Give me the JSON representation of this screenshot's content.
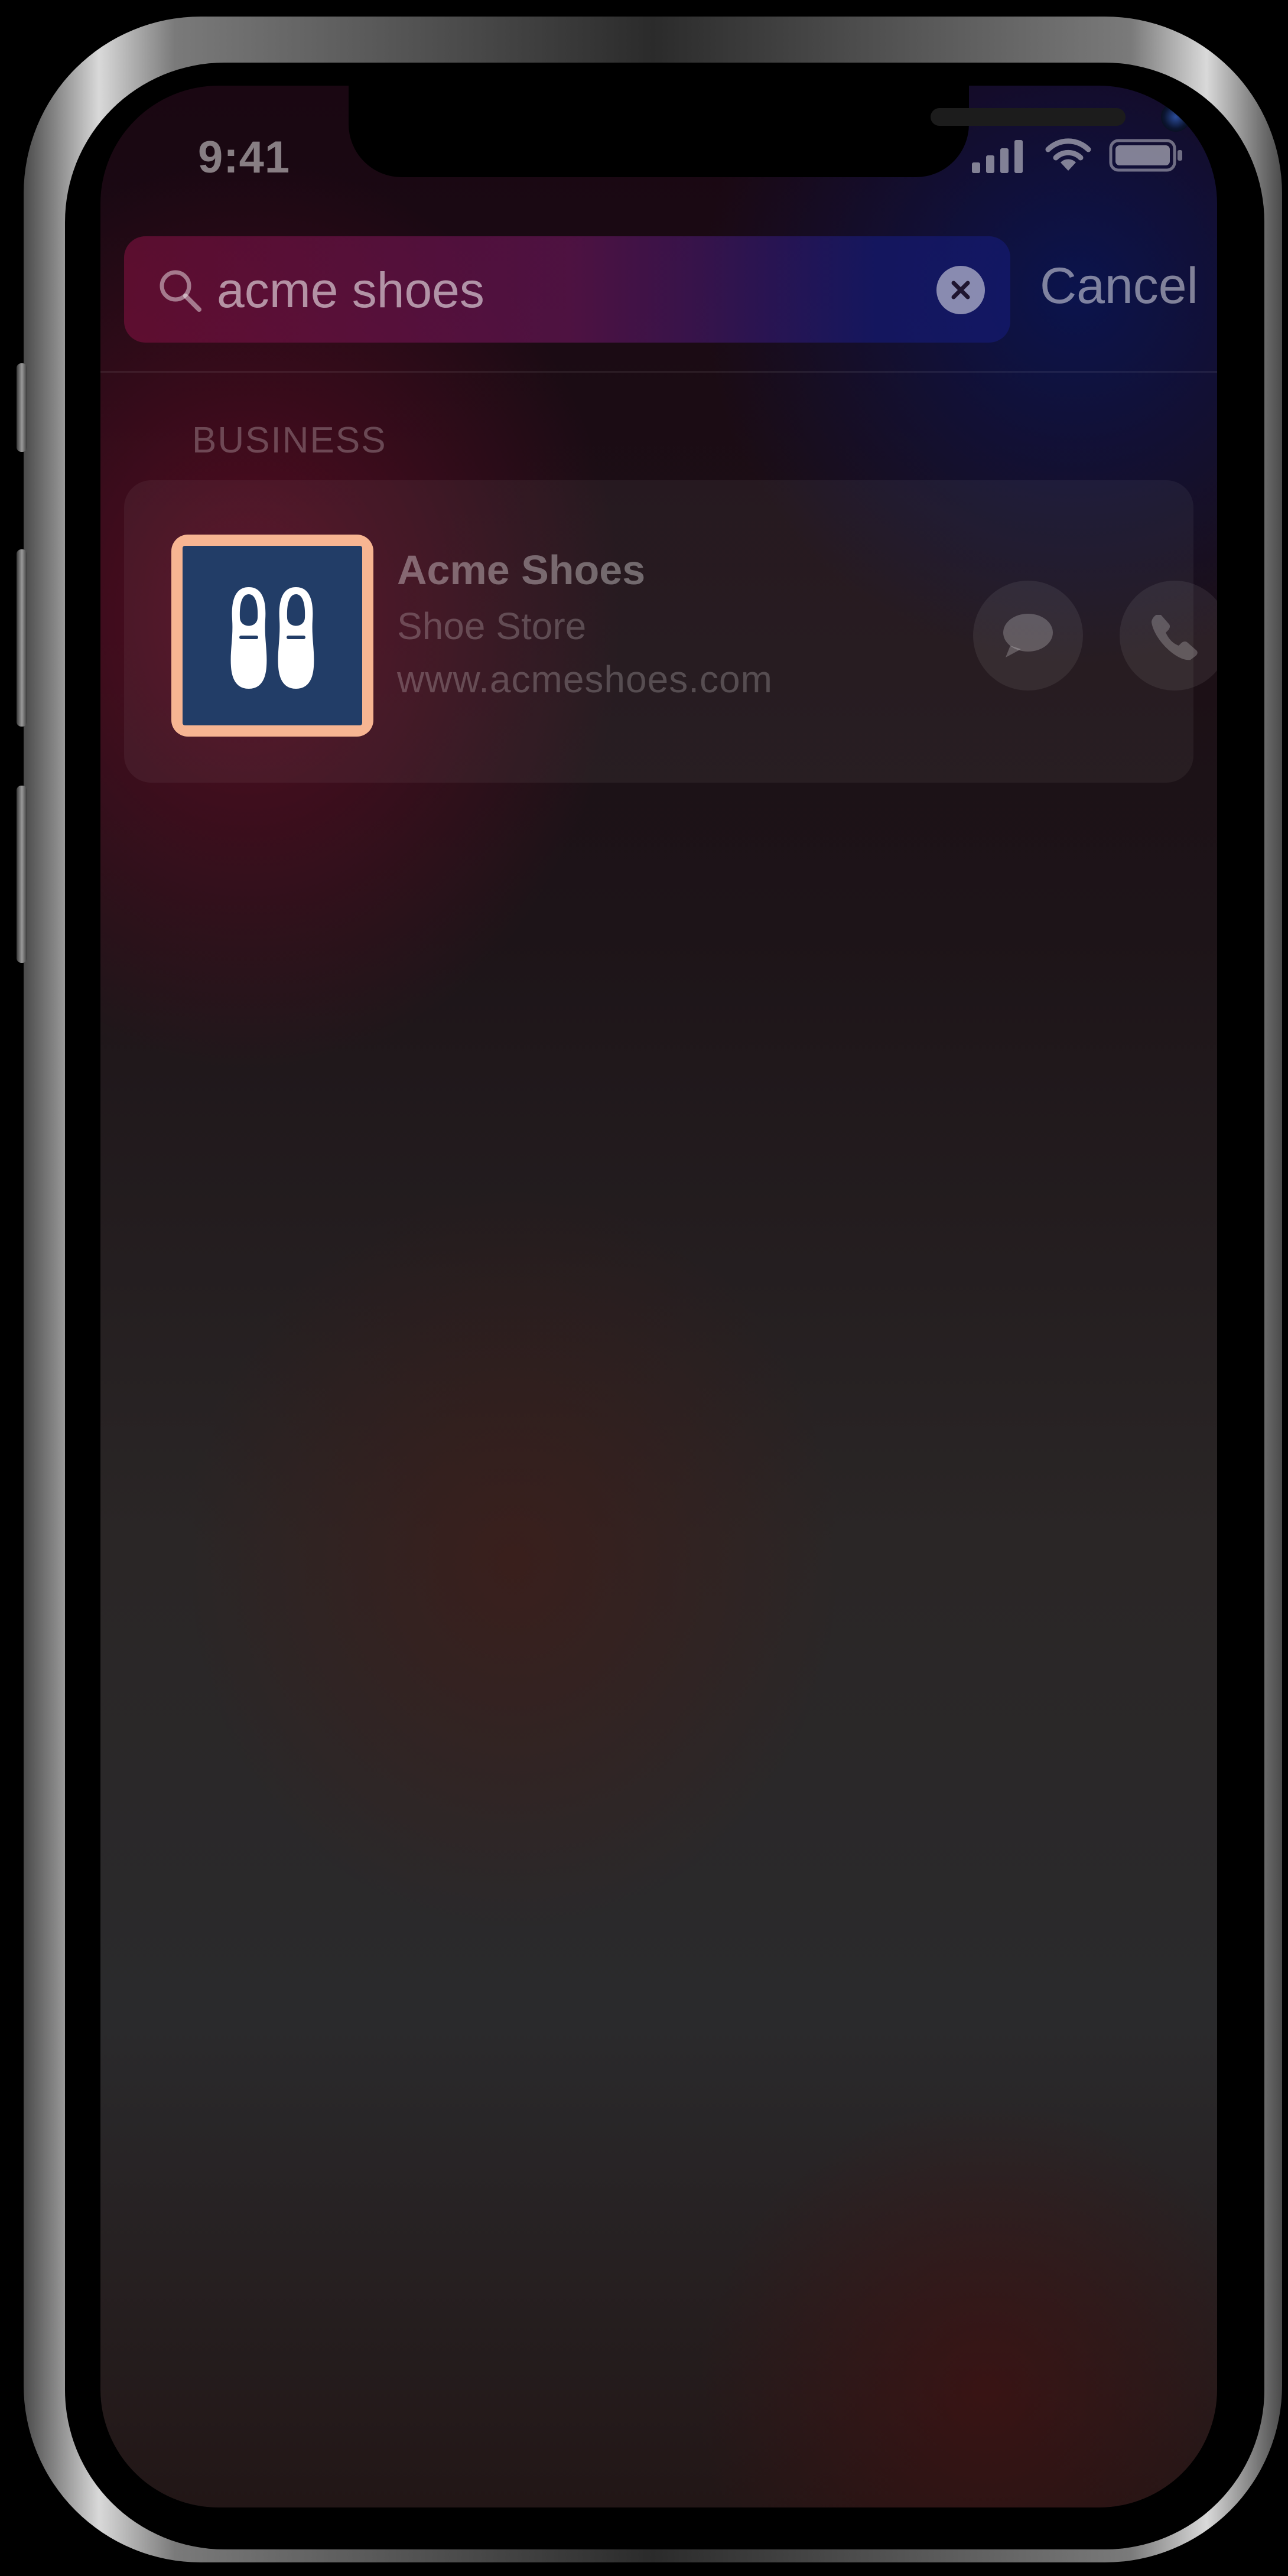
{
  "status_bar": {
    "time": "9:41",
    "icons": [
      "cellular-signal-icon",
      "wifi-icon",
      "battery-icon"
    ]
  },
  "search": {
    "query": "acme shoes",
    "cancel_label": "Cancel",
    "icons": [
      "search-icon",
      "clear-icon"
    ]
  },
  "results": {
    "section_header": "BUSINESS",
    "business": {
      "name": "Acme Shoes",
      "category": "Shoe Store",
      "url": "www.acmeshoes.com",
      "icon": "shoes-icon",
      "actions": [
        "message-icon",
        "phone-icon"
      ]
    }
  },
  "colors": {
    "highlight_border": "#f7b592",
    "app_icon_background": "#223d67"
  }
}
